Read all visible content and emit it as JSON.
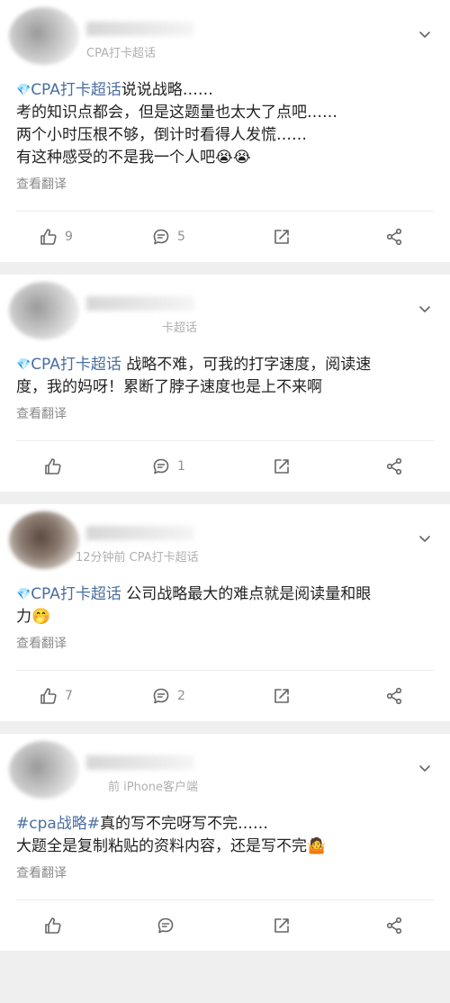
{
  "posts": [
    {
      "meta": "CPA打卡超话",
      "topic": "CPA打卡超话",
      "lines": [
        "说说战略……",
        "考的知识点都会，但是这题量也太大了点吧……",
        "两个小时压根不够，倒计时看得人发慌……",
        "有这种感受的不是我一个人吧😭😭"
      ],
      "translate": "查看翻译",
      "likes": "9",
      "comments": "5"
    },
    {
      "meta": "卡超话",
      "topic": "CPA打卡超话",
      "lines": [
        " 战略不难，可我的打字速度，阅读速",
        "度，我的妈呀！累断了脖子速度也是上不来啊"
      ],
      "translate": "查看翻译",
      "likes": "",
      "comments": "1"
    },
    {
      "meta": "12分钟前 CPA打卡超话",
      "topic": "CPA打卡超话",
      "lines": [
        " 公司战略最大的难点就是阅读量和眼",
        "力🤭"
      ],
      "translate": "查看翻译",
      "likes": "7",
      "comments": "2"
    },
    {
      "meta": "前 iPhone客户端",
      "topic": "#cpa战略#",
      "lines": [
        "真的写不完呀写不完……",
        "大题全是复制粘贴的资料内容，还是写不完🤷"
      ],
      "translate": "查看翻译",
      "likes": "",
      "comments": ""
    }
  ]
}
